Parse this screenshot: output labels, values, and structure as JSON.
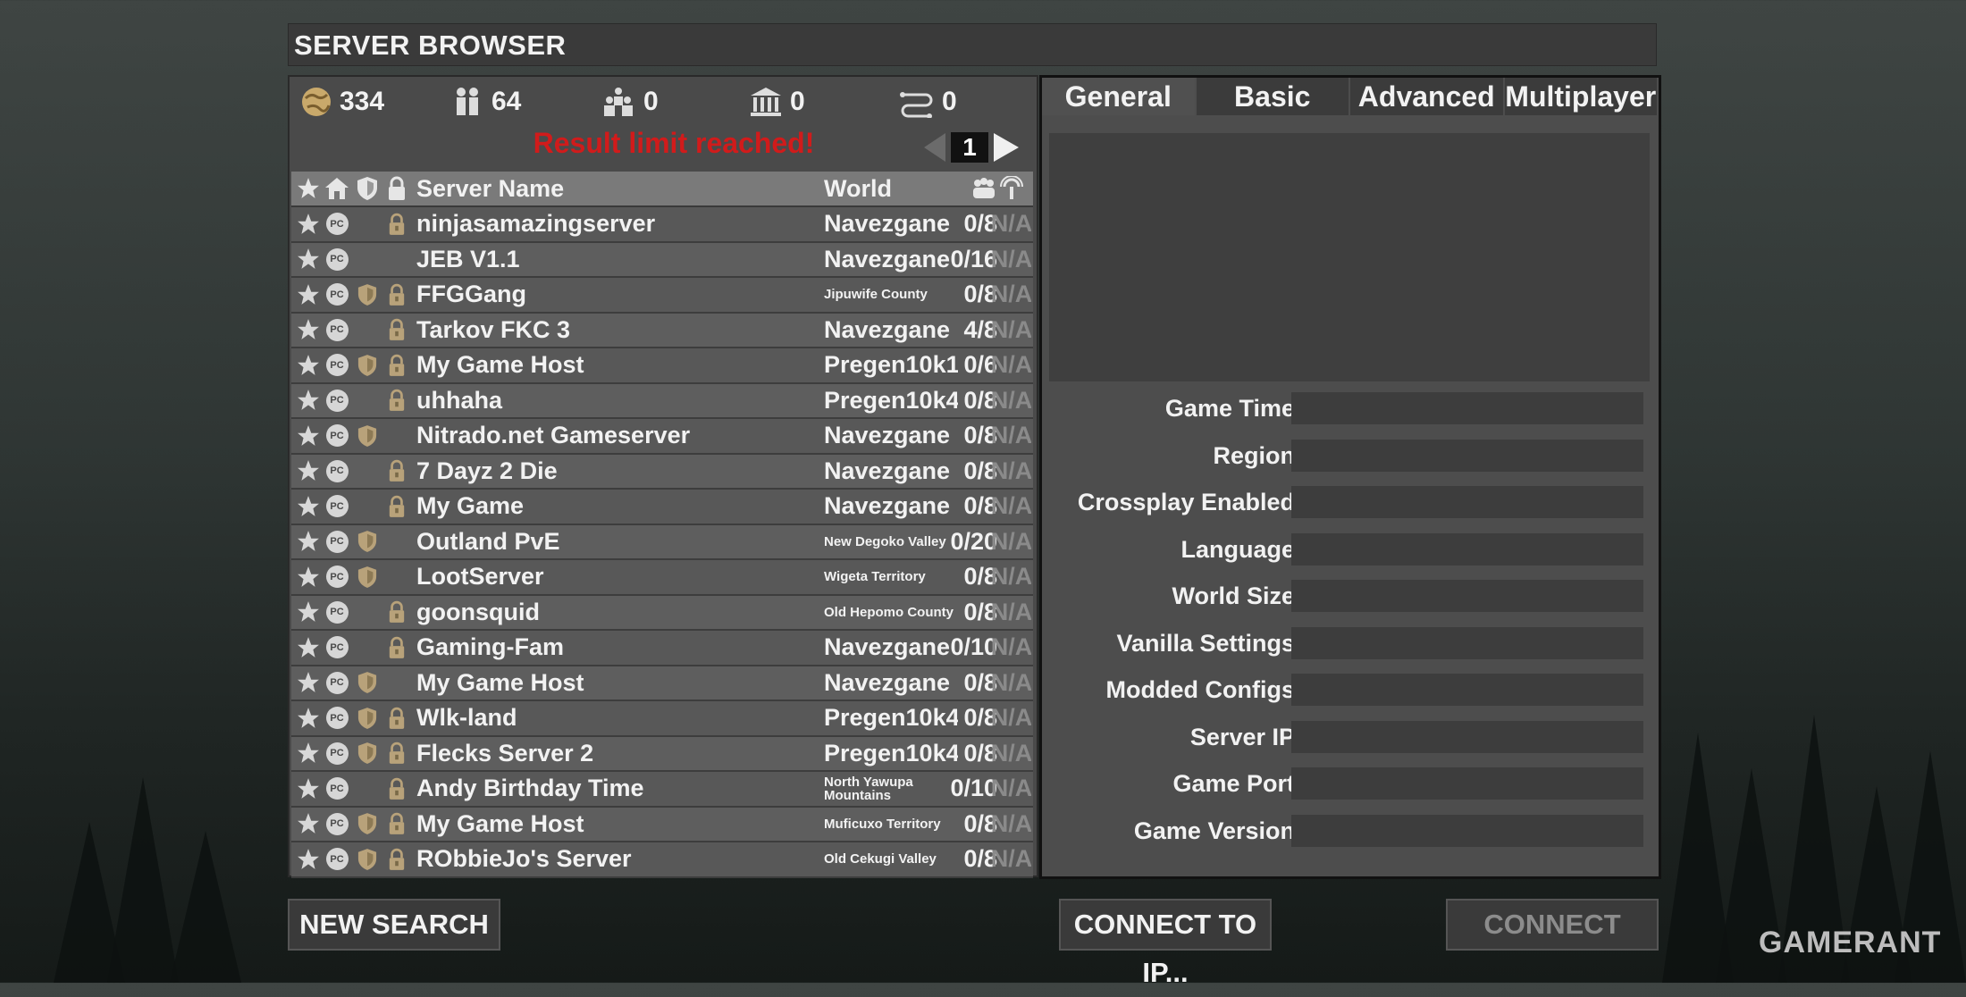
{
  "window": {
    "title": "SERVER BROWSER"
  },
  "stats": {
    "total_servers": "334",
    "players": "64",
    "friends": "0",
    "lan": "0",
    "ping_filter": "0"
  },
  "status": {
    "result_limit": "Result limit reached!"
  },
  "pager": {
    "page": "1"
  },
  "table": {
    "headers": {
      "name": "Server Name",
      "world": "World"
    },
    "rows": [
      {
        "name": "ninjasamazingserver",
        "world": "Navezgane",
        "players": "0/8",
        "ping": "N/A",
        "shield": false,
        "lock": true,
        "small": false
      },
      {
        "name": "JEB V1.1",
        "world": "Navezgane",
        "players": "0/16",
        "ping": "N/A",
        "shield": false,
        "lock": false,
        "small": false
      },
      {
        "name": "FFGGang",
        "world": "Jipuwife County",
        "players": "0/8",
        "ping": "N/A",
        "shield": true,
        "lock": true,
        "small": true
      },
      {
        "name": "Tarkov FKC 3",
        "world": "Navezgane",
        "players": "4/8",
        "ping": "N/A",
        "shield": false,
        "lock": true,
        "small": false
      },
      {
        "name": "My Game Host",
        "world": "Pregen10k1",
        "players": "0/6",
        "ping": "N/A",
        "shield": true,
        "lock": true,
        "small": false
      },
      {
        "name": "uhhaha",
        "world": "Pregen10k4",
        "players": "0/8",
        "ping": "N/A",
        "shield": false,
        "lock": true,
        "small": false
      },
      {
        "name": "Nitrado.net Gameserver",
        "world": "Navezgane",
        "players": "0/8",
        "ping": "N/A",
        "shield": true,
        "lock": false,
        "small": false
      },
      {
        "name": "7 Dayz 2 Die",
        "world": "Navezgane",
        "players": "0/8",
        "ping": "N/A",
        "shield": false,
        "lock": true,
        "small": false
      },
      {
        "name": "My Game",
        "world": "Navezgane",
        "players": "0/8",
        "ping": "N/A",
        "shield": false,
        "lock": true,
        "small": false
      },
      {
        "name": "Outland PvE",
        "world": "New Degoko Valley",
        "players": "0/20",
        "ping": "N/A",
        "shield": true,
        "lock": false,
        "small": true
      },
      {
        "name": "LootServer",
        "world": "Wigeta Territory",
        "players": "0/8",
        "ping": "N/A",
        "shield": true,
        "lock": false,
        "small": true
      },
      {
        "name": "goonsquid",
        "world": "Old Hepomo County",
        "players": "0/8",
        "ping": "N/A",
        "shield": false,
        "lock": true,
        "small": true
      },
      {
        "name": "Gaming-Fam",
        "world": "Navezgane",
        "players": "0/10",
        "ping": "N/A",
        "shield": false,
        "lock": true,
        "small": false
      },
      {
        "name": "My Game Host",
        "world": "Navezgane",
        "players": "0/8",
        "ping": "N/A",
        "shield": true,
        "lock": false,
        "small": false
      },
      {
        "name": "Wlk-land",
        "world": "Pregen10k4",
        "players": "0/8",
        "ping": "N/A",
        "shield": true,
        "lock": true,
        "small": false
      },
      {
        "name": "Flecks Server 2",
        "world": "Pregen10k4",
        "players": "0/8",
        "ping": "N/A",
        "shield": true,
        "lock": true,
        "small": false
      },
      {
        "name": "Andy Birthday Time",
        "world": "North Yawupa Mountains",
        "players": "0/10",
        "ping": "N/A",
        "shield": false,
        "lock": true,
        "small": true
      },
      {
        "name": "My Game Host",
        "world": "Muficuxo Territory",
        "players": "0/8",
        "ping": "N/A",
        "shield": true,
        "lock": true,
        "small": true
      },
      {
        "name": "RObbieJo's Server",
        "world": "Old Cekugi Valley",
        "players": "0/8",
        "ping": "N/A",
        "shield": true,
        "lock": true,
        "small": true
      }
    ]
  },
  "details": {
    "tabs": [
      "General",
      "Basic",
      "Advanced",
      "Multiplayer"
    ],
    "fields": [
      {
        "label": "Game Time",
        "value": ""
      },
      {
        "label": "Region",
        "value": ""
      },
      {
        "label": "Crossplay Enabled",
        "value": ""
      },
      {
        "label": "Language",
        "value": ""
      },
      {
        "label": "World Size",
        "value": ""
      },
      {
        "label": "Vanilla Settings",
        "value": ""
      },
      {
        "label": "Modded Configs",
        "value": ""
      },
      {
        "label": "Server IP",
        "value": ""
      },
      {
        "label": "Game Port",
        "value": ""
      },
      {
        "label": "Game Version",
        "value": ""
      }
    ]
  },
  "buttons": {
    "new_search": "NEW SEARCH",
    "connect_to_ip": "CONNECT TO IP...",
    "connect": "CONNECT"
  },
  "badge": {
    "pc": "PC"
  },
  "watermark": "GAMERANT",
  "colors": {
    "warning": "#d11b1b",
    "lock": "#b8a27a",
    "shield": "#b8a27a"
  }
}
